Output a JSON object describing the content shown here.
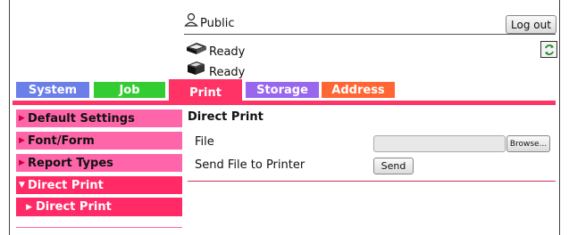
{
  "header": {
    "user_label": "Public",
    "logout_label": "Log out",
    "refresh_icon": "refresh-icon",
    "status": [
      {
        "icon": "printer-icon",
        "text": "Ready"
      },
      {
        "icon": "scanner-icon",
        "text": "Ready"
      }
    ]
  },
  "tabs": [
    {
      "label": "System",
      "color": "#6b7fe9"
    },
    {
      "label": "Job",
      "color": "#33cc33"
    },
    {
      "label": "Print",
      "color": "#ff3366",
      "active": true
    },
    {
      "label": "Storage",
      "color": "#9966ee"
    },
    {
      "label": "Address",
      "color": "#ff6633"
    }
  ],
  "sidebar": {
    "items": [
      {
        "label": "Default Settings"
      },
      {
        "label": "Font/Form"
      },
      {
        "label": "Report Types"
      },
      {
        "label": "Direct Print",
        "expanded": true
      }
    ],
    "sub_items": [
      {
        "label": "Direct Print",
        "active": true
      }
    ]
  },
  "main": {
    "title": "Direct Print",
    "file_label": "File",
    "file_value": "",
    "browse_label": "Browse...",
    "send_label_text": "Send File to Printer",
    "send_button": "Send"
  }
}
